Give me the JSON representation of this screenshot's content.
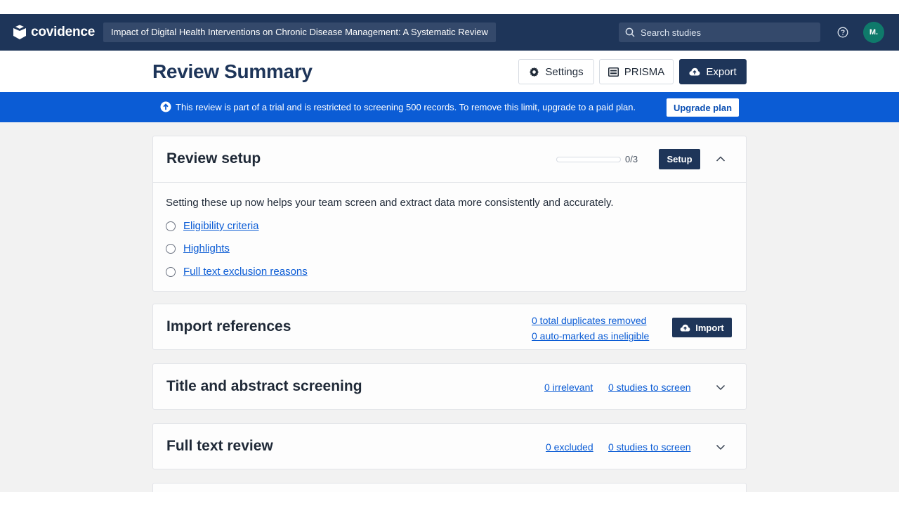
{
  "app": {
    "logo_text": "covidence",
    "review_title": "Impact of Digital Health Interventions on Chronic Disease Management: A Systematic Review",
    "search_placeholder": "Search studies",
    "avatar_initials": "M."
  },
  "header": {
    "title": "Review Summary",
    "settings_label": "Settings",
    "prisma_label": "PRISMA",
    "export_label": "Export"
  },
  "banner": {
    "text": "This review is part of a trial and is restricted to screening 500 records. To remove this limit, upgrade to a paid plan.",
    "button_label": "Upgrade plan"
  },
  "review_setup": {
    "title": "Review setup",
    "progress_label": "0/3",
    "progress_fraction": 0,
    "button_label": "Setup",
    "description": "Setting these up now helps your team screen and extract data more consistently and accurately.",
    "items": [
      {
        "label": "Eligibility criteria"
      },
      {
        "label": "Highlights"
      },
      {
        "label": "Full text exclusion reasons"
      }
    ]
  },
  "import_references": {
    "title": "Import references",
    "duplicates_link": "0 total duplicates removed",
    "ineligible_link": "0 auto-marked as ineligible",
    "button_label": "Import"
  },
  "title_abstract": {
    "title": "Title and abstract screening",
    "irrelevant_link": "0 irrelevant",
    "to_screen_link": "0 studies to screen"
  },
  "full_text": {
    "title": "Full text review",
    "excluded_link": "0 excluded",
    "to_screen_link": "0 studies to screen"
  },
  "colors": {
    "nav": "#1e3559",
    "banner": "#0b5cd5",
    "link": "#0b5cd5",
    "avatar": "#0f7a6b"
  }
}
